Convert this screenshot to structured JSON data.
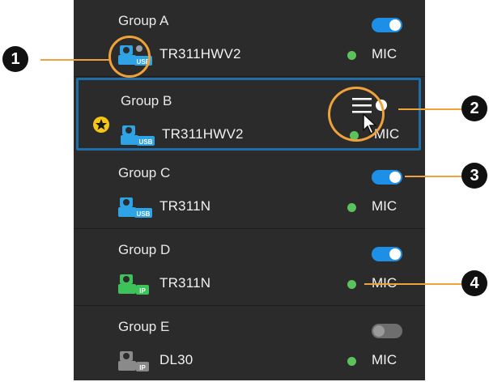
{
  "groups": [
    {
      "name": "Group A",
      "device": "TR311HWV2",
      "status_label": "MIC",
      "camera_type": "USB",
      "toggle_on": true,
      "status_color": "#5cc25c",
      "camera_color": "#2ea3e6"
    },
    {
      "name": "Group B",
      "device": "TR311HWV2",
      "status_label": "MIC",
      "camera_type": "USB",
      "toggle_on": true,
      "status_color": "#5cc25c",
      "camera_color": "#2ea3e6",
      "selected": true
    },
    {
      "name": "Group C",
      "device": "TR311N",
      "status_label": "MIC",
      "camera_type": "USB",
      "toggle_on": true,
      "status_color": "#5cc25c",
      "camera_color": "#2ea3e6"
    },
    {
      "name": "Group D",
      "device": "TR311N",
      "status_label": "MIC",
      "camera_type": "IP",
      "toggle_on": true,
      "status_color": "#5cc25c",
      "camera_color": "#3ec25a"
    },
    {
      "name": "Group E",
      "device": "DL30",
      "status_label": "MIC",
      "camera_type": "IP",
      "toggle_on": false,
      "status_color": "#5cc25c",
      "camera_color": "#8a8a8a"
    }
  ],
  "callouts": [
    "1",
    "2",
    "3",
    "4"
  ],
  "colors": {
    "toggle_on": "#1e8fe6",
    "toggle_off": "#6e6e6e",
    "selection_border": "#1f6ea8",
    "callout": "#f0a23a",
    "star_badge": "#f5c518"
  },
  "icons": {
    "menu": "hamburger-menu-icon",
    "star": "star-icon",
    "cursor": "mouse-cursor-icon",
    "camera": "camera-icon"
  }
}
